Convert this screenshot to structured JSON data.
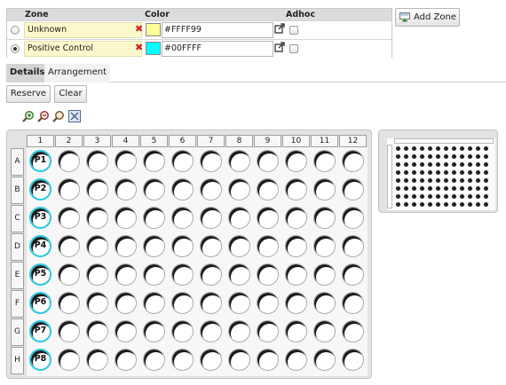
{
  "zone_table": {
    "headers": {
      "zone": "Zone",
      "color": "Color",
      "adhoc": "Adhoc"
    },
    "rows": [
      {
        "name": "Unknown",
        "color": "#FFFF99",
        "swatch": "#FFFF99",
        "selected": false,
        "adhoc": false
      },
      {
        "name": "Positive Control",
        "color": "#00FFFF",
        "swatch": "#00FFFF",
        "selected": true,
        "adhoc": false
      }
    ]
  },
  "add_zone_label": "Add Zone",
  "tabs": [
    {
      "label": "Details",
      "active": true
    },
    {
      "label": "Arrangement",
      "active": false
    }
  ],
  "buttons": {
    "reserve": "Reserve",
    "clear": "Clear"
  },
  "zoom_tools": [
    "zoom-in-icon",
    "zoom-out-icon",
    "zoom-reset-icon",
    "fit-to-view-icon"
  ],
  "plate": {
    "columns": [
      "1",
      "2",
      "3",
      "4",
      "5",
      "6",
      "7",
      "8",
      "9",
      "10",
      "11",
      "12"
    ],
    "rows": [
      "A",
      "B",
      "C",
      "D",
      "E",
      "F",
      "G",
      "H"
    ],
    "assigned_color": "#2EC6E0",
    "assigned_wells": [
      {
        "row": "A",
        "col": "1",
        "label": "P1"
      },
      {
        "row": "B",
        "col": "1",
        "label": "P2"
      },
      {
        "row": "C",
        "col": "1",
        "label": "P3"
      },
      {
        "row": "D",
        "col": "1",
        "label": "P4"
      },
      {
        "row": "E",
        "col": "1",
        "label": "P5"
      },
      {
        "row": "F",
        "col": "1",
        "label": "P6"
      },
      {
        "row": "G",
        "col": "1",
        "label": "P7"
      },
      {
        "row": "H",
        "col": "1",
        "label": "P8"
      }
    ]
  }
}
